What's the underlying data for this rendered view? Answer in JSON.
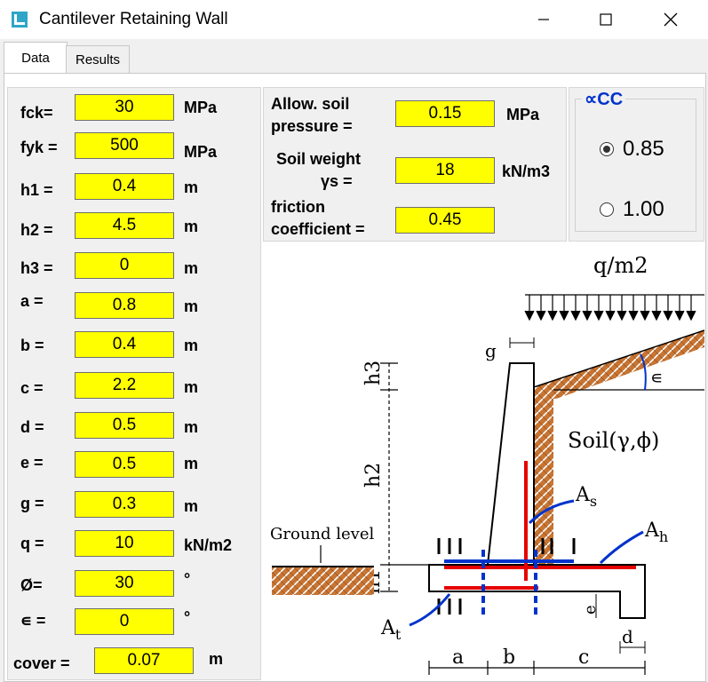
{
  "window": {
    "title": "Cantilever Retaining Wall"
  },
  "tabs": [
    {
      "label": "Data"
    },
    {
      "label": "Results"
    }
  ],
  "params": [
    {
      "label": "fck=",
      "value": "30",
      "unit": "MPa"
    },
    {
      "label": "fyk =",
      "value": "500",
      "unit": "MPa"
    },
    {
      "label": "h1 =",
      "value": "0.4",
      "unit": "m"
    },
    {
      "label": "h2 =",
      "value": "4.5",
      "unit": "m"
    },
    {
      "label": "h3 =",
      "value": "0",
      "unit": "m"
    },
    {
      "label": "a  =",
      "value": "0.8",
      "unit": "m"
    },
    {
      "label": "b =",
      "value": "0.4",
      "unit": "m"
    },
    {
      "label": "c =",
      "value": "2.2",
      "unit": "m"
    },
    {
      "label": "d =",
      "value": "0.5",
      "unit": "m"
    },
    {
      "label": "e =",
      "value": "0.5",
      "unit": "m"
    },
    {
      "label": "g =",
      "value": "0.3",
      "unit": "m"
    },
    {
      "label": "q =",
      "value": "10",
      "unit": "kN/m2"
    },
    {
      "label": "Ø=",
      "value": "30",
      "unit": "°"
    },
    {
      "label": "∊ =",
      "value": "0",
      "unit": "°"
    }
  ],
  "cover": {
    "label": "cover =",
    "value": "0.07",
    "unit": "m"
  },
  "soil": {
    "allow_label_1": "Allow. soil",
    "allow_label_2": "pressure =",
    "allow_value": "0.15",
    "allow_unit": "MPa",
    "weight_label_1": "Soil weight",
    "weight_label_2": "γs =",
    "weight_value": "18",
    "weight_unit": "kN/m3",
    "friction_label_1": "friction",
    "friction_label_2": "coefficient =",
    "friction_value": "0.45"
  },
  "alpha_cc": {
    "title": "∝CC",
    "options": [
      {
        "label": "0.85",
        "selected": true
      },
      {
        "label": "1.00",
        "selected": false
      }
    ]
  },
  "diagram": {
    "q_label": "q/m2",
    "soil_label": "Soil(γ,ϕ)",
    "ground_label": "Ground level",
    "h1": "h1",
    "h2": "h2",
    "h3": "h3",
    "g": "g",
    "eps": "∊",
    "As": "A",
    "As_sub": "s",
    "Ah": "A",
    "Ah_sub": "h",
    "At": "A",
    "At_sub": "t",
    "a": "a",
    "b": "b",
    "c": "c",
    "d": "d",
    "e": "e"
  },
  "colors": {
    "field": "#ffff00",
    "accent": "#0033cc",
    "soil": "#c87533",
    "rebar_red": "#e60000",
    "rebar_blue": "#0033cc"
  }
}
